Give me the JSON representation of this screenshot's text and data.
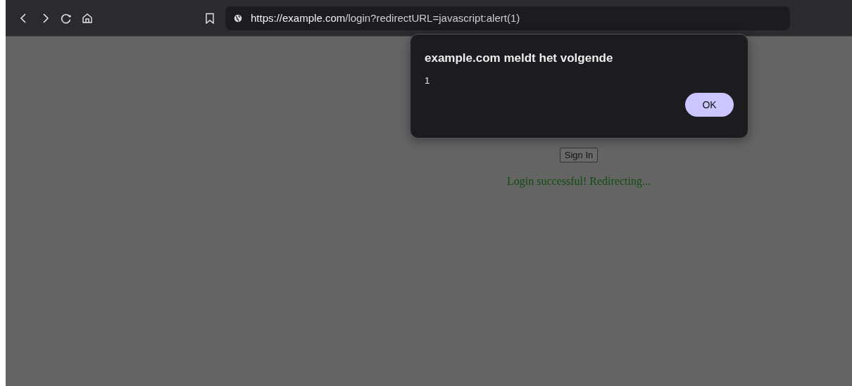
{
  "toolbar": {
    "url": {
      "host": "https://example.com",
      "path": "/login?redirectURL=javascript:alert(1)"
    }
  },
  "page": {
    "button": "Sign In",
    "message": "Login successful! Redirecting..."
  },
  "dialog": {
    "title": "example.com meldt het volgende",
    "message": "1",
    "button": "OK"
  }
}
